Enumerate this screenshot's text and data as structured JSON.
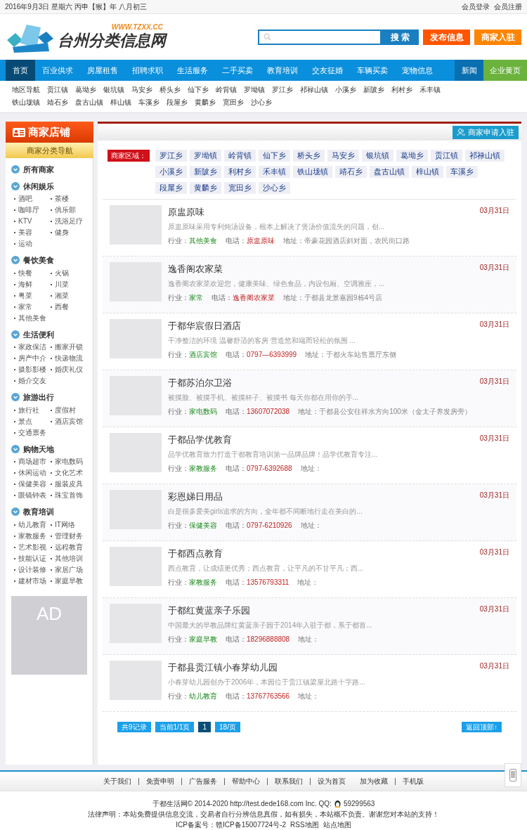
{
  "top_bar": {
    "date": "2016年9月3日 星期六 丙申【猴】年 八月初三",
    "links": [
      "会员登录",
      "会员注册"
    ]
  },
  "header": {
    "logo_text": "台州分类信息网",
    "logo_url": "WWW.TZXX.CC",
    "search_button": "搜 索",
    "buttons": [
      {
        "label": "发布信息",
        "kind": "publish"
      },
      {
        "label": "商家入驻",
        "kind": "join"
      }
    ]
  },
  "nav": [
    {
      "label": "首页",
      "selected": true,
      "kind": "main"
    },
    {
      "label": "百业供求",
      "selected": false,
      "kind": "main"
    },
    {
      "label": "房屋租售",
      "selected": false,
      "kind": "main"
    },
    {
      "label": "招聘求职",
      "selected": false,
      "kind": "main"
    },
    {
      "label": "生活服务",
      "selected": false,
      "kind": "main"
    },
    {
      "label": "二手买卖",
      "selected": false,
      "kind": "main"
    },
    {
      "label": "教育培训",
      "selected": false,
      "kind": "main"
    },
    {
      "label": "交友征婚",
      "selected": false,
      "kind": "main"
    },
    {
      "label": "车辆买卖",
      "selected": false,
      "kind": "main"
    },
    {
      "label": "宠物信息",
      "selected": false,
      "kind": "main"
    },
    {
      "label": "新闻",
      "selected": false,
      "kind": "news"
    },
    {
      "label": "企业黄页",
      "selected": false,
      "kind": "yellow-pages"
    }
  ],
  "region_nav": [
    "地区导航",
    "贡江镇",
    "葛坳乡",
    "银坑镇",
    "马安乡",
    "桥头乡",
    "仙下乡",
    "岭背镇",
    "罗坳镇",
    "罗江乡",
    "祁禄山镇",
    "小溪乡",
    "新陂乡",
    "利村乡",
    "禾丰镇",
    "铁山垅镇",
    "靖石乡",
    "盘古山镇",
    "梓山镇",
    "车溪乡",
    "段屋乡",
    "黄麟乡",
    "宽田乡",
    "沙心乡"
  ],
  "sidebar": {
    "title": "商家店铺",
    "subtitle": "商家分类导航",
    "categories": [
      {
        "name": "所有商家"
      },
      {
        "name": "休闲娱乐",
        "items": [
          "酒吧",
          "茶楼",
          "咖啡厅",
          "俱乐部",
          "KTV",
          "洗浴足疗",
          "美容",
          "健身",
          "运动"
        ]
      },
      {
        "name": "餐饮美食",
        "items": [
          "快餐",
          "火锅",
          "海鲜",
          "川菜",
          "粤菜",
          "湘菜",
          "家常",
          "西餐",
          "其他美食"
        ]
      },
      {
        "name": "生活便利",
        "items": [
          "家政保洁",
          "搬家开锁",
          "房产中介",
          "快递物流",
          "摄影影楼",
          "婚庆礼仪",
          "婚介交友"
        ]
      },
      {
        "name": "旅游出行",
        "items": [
          "旅行社",
          "度假村",
          "景点",
          "酒店宾馆",
          "交通票务"
        ]
      },
      {
        "name": "购物天地",
        "items": [
          "商场超市",
          "家电数码",
          "休闲运动",
          "文化艺术",
          "保健美容",
          "服装皮具",
          "眼镜钟表",
          "珠宝首饰"
        ]
      },
      {
        "name": "教育培训",
        "items": [
          "幼儿教育",
          "IT网络",
          "家教服务",
          "管理财务",
          "艺术影视",
          "远程教育",
          "技能认证",
          "其他培训",
          "设计装修",
          "家居广场",
          "建材市场",
          "家庭早教"
        ]
      }
    ],
    "ad": "AD"
  },
  "content": {
    "apply_button": "商家申请入驻",
    "region_label": "商家区域：",
    "regions": [
      "罗江乡",
      "罗坳镇",
      "岭背镇",
      "仙下乡",
      "桥头乡",
      "马安乡",
      "银坑镇",
      "葛坳乡",
      "贡江镇",
      "祁禄山镇",
      "小溪乡",
      "新陂乡",
      "利村乡",
      "禾丰镇",
      "铁山垅镇",
      "靖石乡",
      "盘古山镇",
      "梓山镇",
      "车溪乡",
      "段屋乡",
      "黄麟乡",
      "宽田乡",
      "沙心乡"
    ],
    "listings": [
      {
        "title": "原盅原味",
        "date": "03月31日",
        "description": "原盅原味采用专利炖汤设备，根本上解决了煲汤价值流失的问题，创...",
        "fields": [
          {
            "kind": "industry",
            "label": "行业：",
            "value": "其他美食"
          },
          {
            "kind": "phone",
            "label": "电话：",
            "value": "原盅原味"
          },
          {
            "kind": "address",
            "label": "地址：",
            "value": "帝豪花园酒店斜对面，农民街口路"
          }
        ]
      },
      {
        "title": "逸香阁农家菜",
        "date": "03月31日",
        "description": "逸香阁农家菜欢迎您，健康美味、绿色食品，内设包厢、空调雅座，...",
        "fields": [
          {
            "kind": "industry",
            "label": "行业：",
            "value": "家常"
          },
          {
            "kind": "phone",
            "label": "电话：",
            "value": "逸香阁农家菜"
          },
          {
            "kind": "address",
            "label": "地址：",
            "value": "于都县龙景嘉园9栋4号店"
          }
        ]
      },
      {
        "title": "于都华宸假日酒店",
        "date": "03月31日",
        "description": "干净整洁的环境 温馨舒适的客房 营造悠和端而轻松的氛围 ...",
        "fields": [
          {
            "kind": "industry",
            "label": "行业：",
            "value": "酒店宾馆"
          },
          {
            "kind": "phone",
            "label": "电话：",
            "value": "0797—6393999"
          },
          {
            "kind": "address",
            "label": "地址：",
            "value": "于都火车站售票厅东侧"
          }
        ]
      },
      {
        "title": "于都苏泊尔卫浴",
        "date": "03月31日",
        "description": "被摸脸、被摸手机、被摸杯子、被摸书 每天你都在用你的手...",
        "fields": [
          {
            "kind": "industry",
            "label": "行业：",
            "value": "家电数码"
          },
          {
            "kind": "phone",
            "label": "电话：",
            "value": "13607072038"
          },
          {
            "kind": "address",
            "label": "地址：",
            "value": "于都县公安往祥水方向100米（金太子养发房旁）"
          }
        ]
      },
      {
        "title": "于都品学优教育",
        "date": "03月31日",
        "description": "品学优教育致力打造于都教育培训第一品牌品牌！品学优教育专注...",
        "fields": [
          {
            "kind": "industry",
            "label": "行业：",
            "value": "家教服务"
          },
          {
            "kind": "phone",
            "label": "电话：",
            "value": "0797-6392688"
          },
          {
            "kind": "address",
            "label": "地址："
          }
        ]
      },
      {
        "title": "彩恩娣日用品",
        "date": "03月31日",
        "description": "白是很多爱美girls追求的方向，全年都不间断地行走在美白的...",
        "fields": [
          {
            "kind": "industry",
            "label": "行业：",
            "value": "保健美容"
          },
          {
            "kind": "phone",
            "label": "电话：",
            "value": "0797-6210926"
          },
          {
            "kind": "address",
            "label": "地址："
          }
        ]
      },
      {
        "title": "于都西点教育",
        "date": "03月31日",
        "description": "西点教育，让成绩更优秀；西点教育，让平凡的不甘平凡；西...",
        "fields": [
          {
            "kind": "industry",
            "label": "行业：",
            "value": "家教服务"
          },
          {
            "kind": "phone",
            "label": "电话：",
            "value": "13576793311"
          },
          {
            "kind": "address",
            "label": "地址："
          }
        ]
      },
      {
        "title": "于都红黄蓝亲子乐园",
        "date": "03月31日",
        "description": "中国最大的早教品牌红黄蓝亲子园于2014年入驻于都，系于都首...",
        "fields": [
          {
            "kind": "industry",
            "label": "行业：",
            "value": "家庭早教"
          },
          {
            "kind": "phone",
            "label": "电话：",
            "value": "18296888808"
          },
          {
            "kind": "address",
            "label": "地址："
          }
        ]
      },
      {
        "title": "于都县贡江镇小春芽幼儿园",
        "date": "03月31日",
        "description": "小春芽幼儿园创办于2006年，本园位于贡江镇梁屋北路十字路...",
        "fields": [
          {
            "kind": "industry",
            "label": "行业：",
            "value": "幼儿教育"
          },
          {
            "kind": "phone",
            "label": "电话：",
            "value": "13767763566"
          },
          {
            "kind": "address",
            "label": "地址："
          }
        ]
      }
    ],
    "pagination": [
      {
        "label": "共9记录",
        "selected": false
      },
      {
        "label": "当前1/1页",
        "selected": false
      },
      {
        "label": "1",
        "selected": true
      },
      {
        "label": "18/页",
        "selected": false
      }
    ],
    "back_to_top": "返回顶部↑"
  },
  "footer": {
    "links": [
      {
        "label": "关于我们",
        "divider_before": false
      },
      {
        "label": "免责申明",
        "divider_before": true
      },
      {
        "label": "广告服务",
        "divider_before": true
      },
      {
        "label": "帮助中心",
        "divider_before": true
      },
      {
        "label": "联系我们",
        "divider_before": true
      },
      {
        "label": "设为首页",
        "divider_before": true
      },
      {
        "label": "加为收藏",
        "divider_before": false
      },
      {
        "label": "手机版",
        "divider_before": true
      }
    ],
    "copyright": "于都生活网© 2014-2020 http://test.dede168.com Inc. QQ:",
    "qq": "59299563",
    "legal": "法律声明：本站免费提供信息交流，交易者自行分辨信息真假，如有损失，本站概不负责。谢谢您对本站的支持！",
    "icp": "ICP备案号：赣ICP备15007724号-2",
    "extra_links": [
      "RSS地图",
      "站点地图"
    ]
  }
}
